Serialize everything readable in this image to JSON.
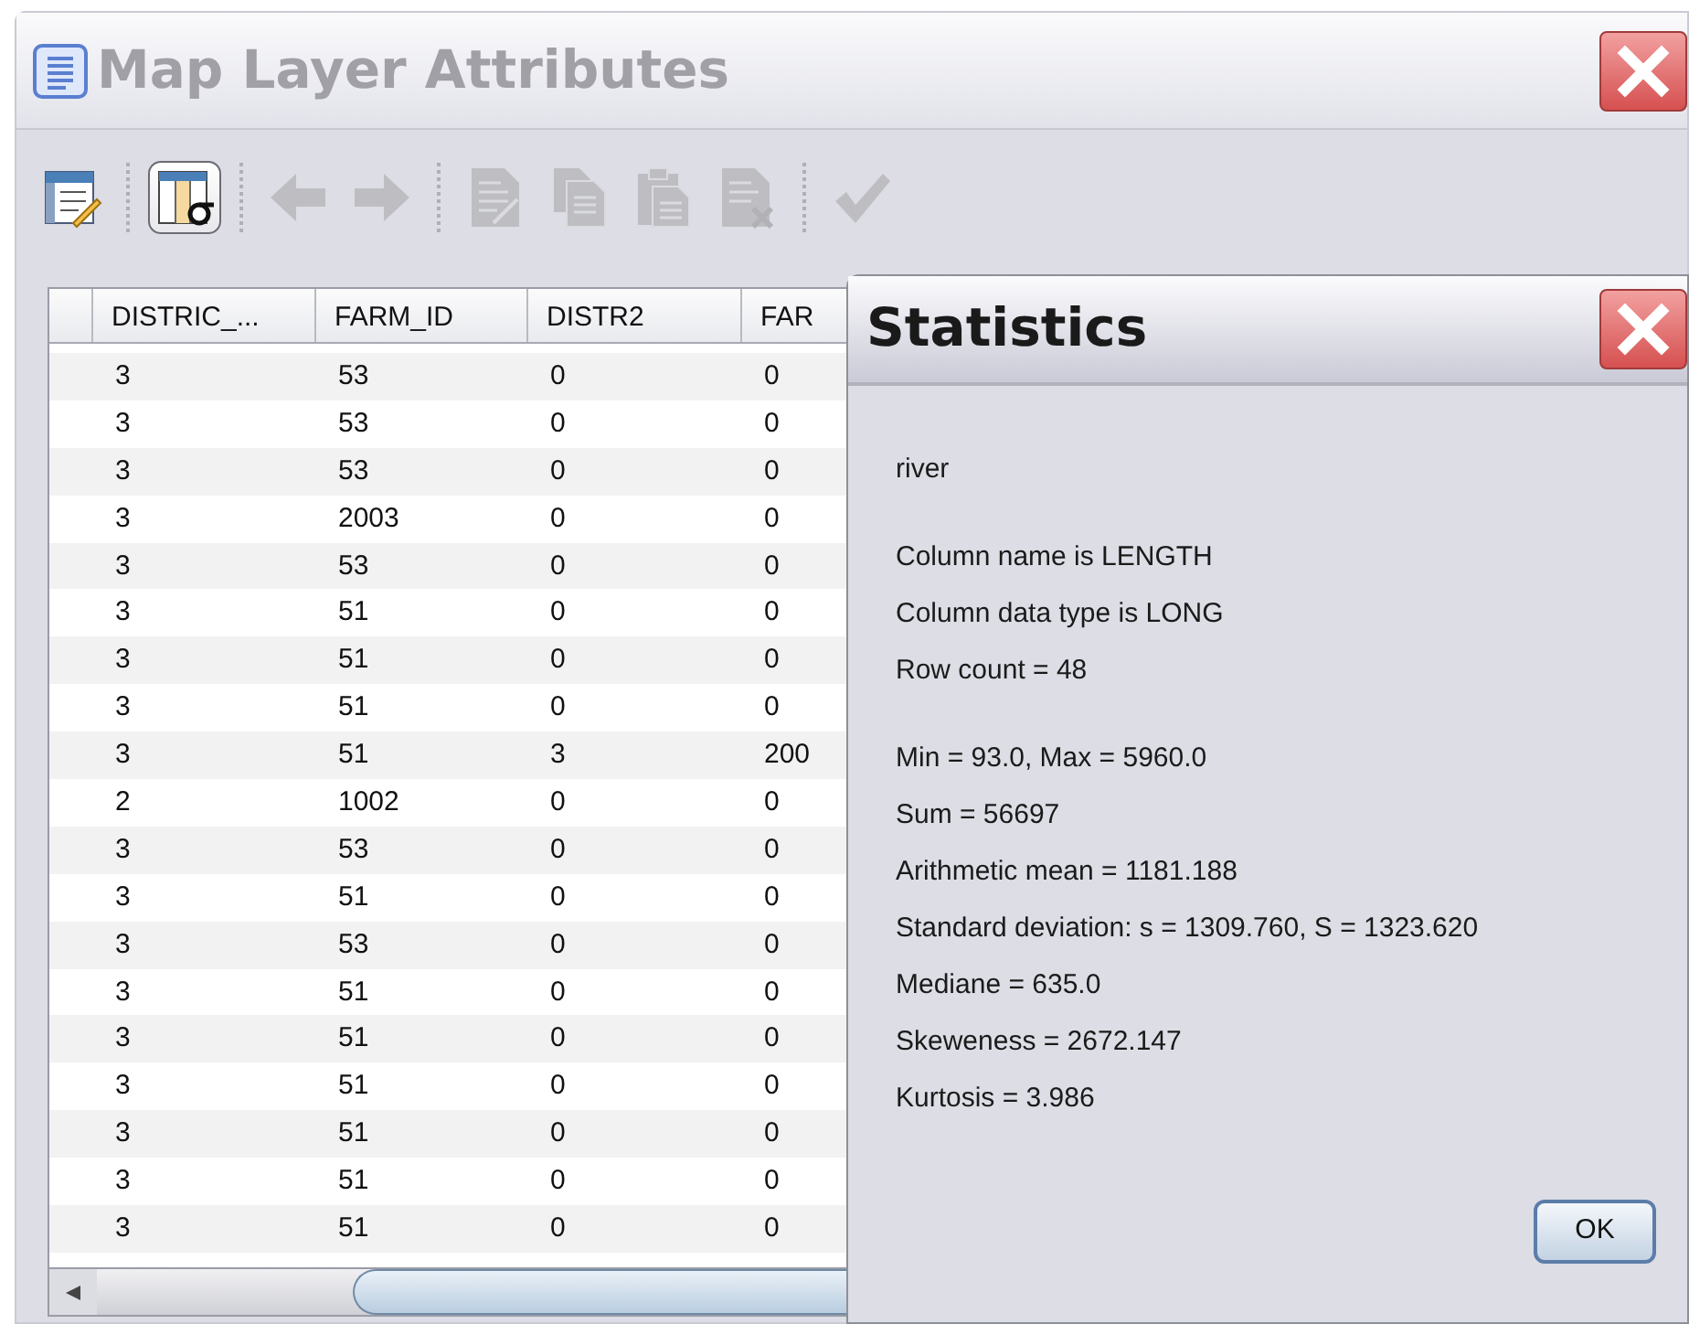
{
  "window": {
    "title": "Map Layer Attributes",
    "active": false
  },
  "toolbar": [
    {
      "kind": "edit",
      "selected": false,
      "disabled": false
    },
    {
      "kind": "statistics",
      "selected": true,
      "disabled": false
    },
    {
      "kind": "back",
      "selected": false,
      "disabled": true
    },
    {
      "kind": "forward",
      "selected": false,
      "disabled": true
    },
    {
      "kind": "doc-edit",
      "selected": false,
      "disabled": true
    },
    {
      "kind": "copy",
      "selected": false,
      "disabled": true
    },
    {
      "kind": "paste",
      "selected": false,
      "disabled": true
    },
    {
      "kind": "doc-delete",
      "selected": false,
      "disabled": true
    },
    {
      "kind": "confirm",
      "selected": false,
      "disabled": true
    }
  ],
  "table": {
    "columns": [
      "DISTRIC_...",
      "FARM_ID",
      "DISTR2",
      "FAR"
    ],
    "rows": [
      [
        "3",
        "53",
        "0",
        "0"
      ],
      [
        "3",
        "53",
        "0",
        "0"
      ],
      [
        "3",
        "53",
        "0",
        "0"
      ],
      [
        "3",
        "2003",
        "0",
        "0"
      ],
      [
        "3",
        "53",
        "0",
        "0"
      ],
      [
        "3",
        "51",
        "0",
        "0"
      ],
      [
        "3",
        "51",
        "0",
        "0"
      ],
      [
        "3",
        "51",
        "0",
        "0"
      ],
      [
        "3",
        "51",
        "3",
        "200"
      ],
      [
        "2",
        "1002",
        "0",
        "0"
      ],
      [
        "3",
        "53",
        "0",
        "0"
      ],
      [
        "3",
        "51",
        "0",
        "0"
      ],
      [
        "3",
        "53",
        "0",
        "0"
      ],
      [
        "3",
        "51",
        "0",
        "0"
      ],
      [
        "3",
        "51",
        "0",
        "0"
      ],
      [
        "3",
        "51",
        "0",
        "0"
      ],
      [
        "3",
        "51",
        "0",
        "0"
      ],
      [
        "3",
        "51",
        "0",
        "0"
      ],
      [
        "3",
        "51",
        "0",
        "0"
      ]
    ]
  },
  "dialog": {
    "title": "Statistics",
    "active": true,
    "groups": [
      [
        "river"
      ],
      [
        "Column name is LENGTH",
        "Column data type is LONG",
        "Row count = 48"
      ],
      [
        "Min = 93.0, Max = 5960.0",
        "Sum = 56697",
        "Arithmetic mean = 1181.188",
        "Standard deviation: s = 1309.760, S = 1323.620",
        "Mediane = 635.0",
        "Skeweness = 2672.147",
        "Kurtosis = 3.986"
      ]
    ],
    "buttons": [
      "OK"
    ]
  }
}
